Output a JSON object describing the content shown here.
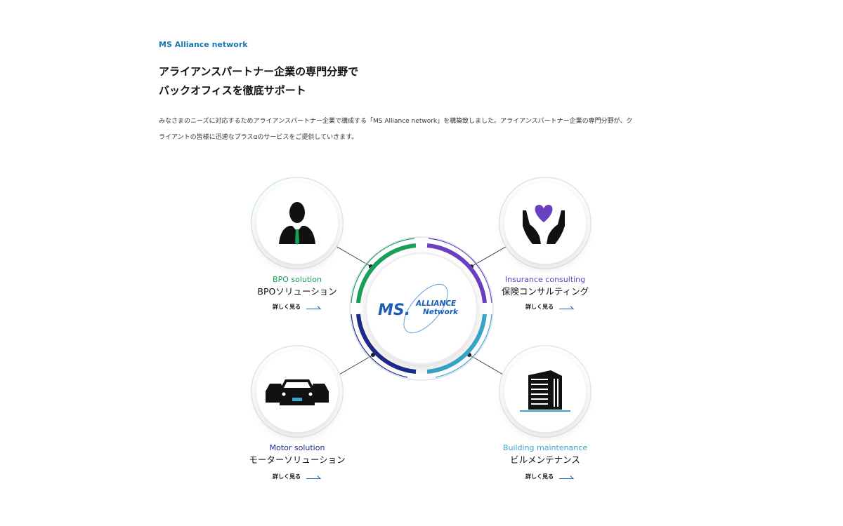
{
  "section": {
    "eyebrow": "MS Alliance network",
    "headline": [
      "アライアンスパートナー企業の専門分野で",
      "バックオフィスを徹底サポート"
    ],
    "description": [
      "みなさまのニーズに対応するためアライアンスパートナー企業で構成する「MS Alliance network」を構築致しました。アライアンスパートナー企業の専門分野が、ク",
      "ライアントの皆様に迅速なプラスαのサービスをご提供していきます。"
    ]
  },
  "hub": {
    "logo_ms": "MS.",
    "logo_alliance": "ALLIANCE",
    "logo_network": "Network"
  },
  "services": [
    {
      "en": "BPO solution",
      "jp": "BPOソリューション",
      "more": "詳しく見る",
      "icon": "businessman-icon",
      "color": "#18a058"
    },
    {
      "en": "Insurance consulting",
      "jp": "保険コンサルティング",
      "more": "詳しく見る",
      "icon": "hands-heart-icon",
      "color": "#6a3fc0"
    },
    {
      "en": "Motor solution",
      "jp": "モーターソリューション",
      "more": "詳しく見る",
      "icon": "cars-icon",
      "color": "#1c2a8c"
    },
    {
      "en": "Building maintenance",
      "jp": "ビルメンテナンス",
      "more": "詳しく見る",
      "icon": "building-icon",
      "color": "#3aa6c8"
    }
  ]
}
